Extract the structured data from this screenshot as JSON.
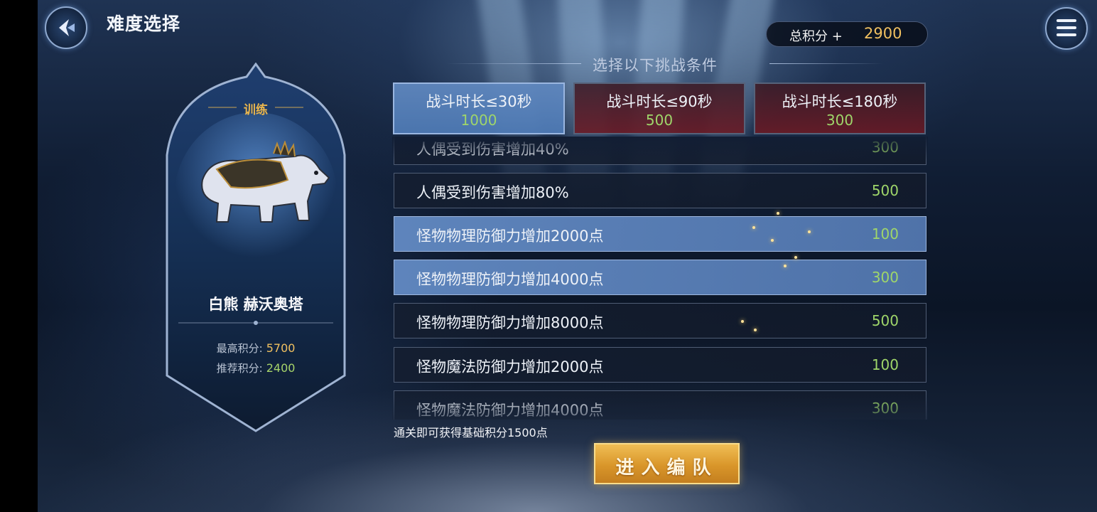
{
  "header": {
    "title": "难度选择",
    "total_score_label": "总积分 +",
    "total_score_value": "2900"
  },
  "boss": {
    "mode_tag": "训练",
    "name": "白熊 赫沃奥塔",
    "best_score_label": "最高积分:",
    "best_score_value": "5700",
    "recommended_score_label": "推荐积分:",
    "recommended_score_value": "2400"
  },
  "challenge": {
    "title": "选择以下挑战条件",
    "time_options": [
      {
        "label": "战斗时长≤30秒",
        "value": "1000",
        "selected": true
      },
      {
        "label": "战斗时长≤90秒",
        "value": "500",
        "selected": false
      },
      {
        "label": "战斗时长≤180秒",
        "value": "300",
        "selected": false
      }
    ],
    "conditions": [
      {
        "label": "人偶受到伤害增加40%",
        "value": "300",
        "selected": false
      },
      {
        "label": "人偶受到伤害增加80%",
        "value": "500",
        "selected": false
      },
      {
        "label": "怪物物理防御力增加2000点",
        "value": "100",
        "selected": true
      },
      {
        "label": "怪物物理防御力增加4000点",
        "value": "300",
        "selected": true
      },
      {
        "label": "怪物物理防御力增加8000点",
        "value": "500",
        "selected": false
      },
      {
        "label": "怪物魔法防御力增加2000点",
        "value": "100",
        "selected": false
      },
      {
        "label": "怪物魔法防御力增加4000点",
        "value": "300",
        "selected": false
      }
    ]
  },
  "footer": {
    "base_note": "通关即可获得基础积分1500点",
    "enter_button": "进入编队"
  },
  "colors": {
    "gold": "#f0c060",
    "green_value": "#9fd66a",
    "selected_blue": "#628ac3",
    "unselected_red": "#6e1923"
  },
  "icons": [
    "back-arrow-icon",
    "menu-icon",
    "polar-bear-icon"
  ]
}
